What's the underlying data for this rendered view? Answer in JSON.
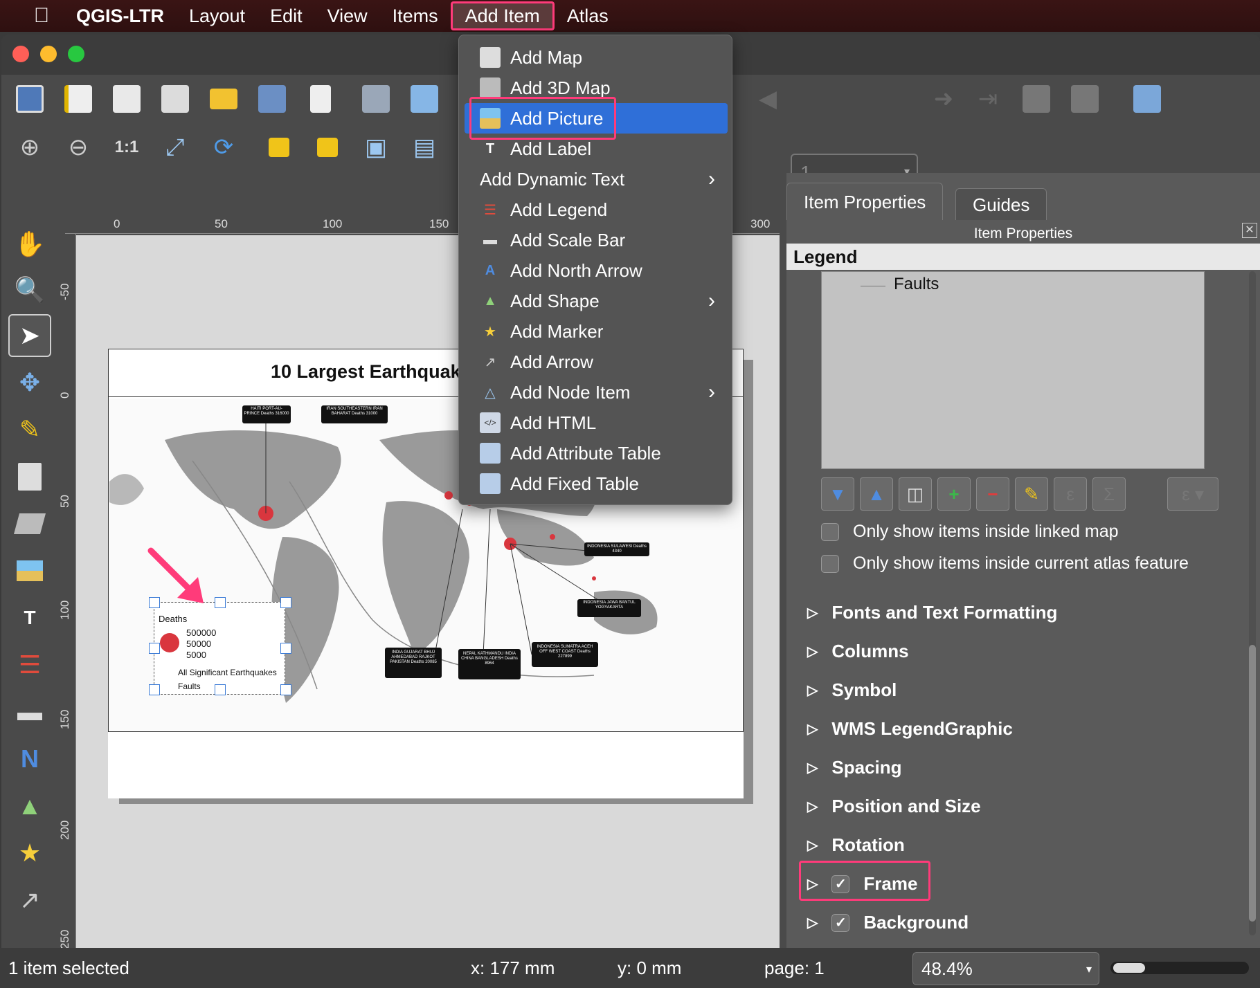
{
  "menubar": {
    "apple": "",
    "items": [
      "QGIS-LTR",
      "Layout",
      "Edit",
      "View",
      "Items",
      "Add Item",
      "Atlas"
    ]
  },
  "toolbar": {
    "page_number": "1"
  },
  "dropdown": {
    "items": [
      {
        "label": "Add Map",
        "icon": "map-icon"
      },
      {
        "label": "Add 3D Map",
        "icon": "3d-map-icon"
      },
      {
        "label": "Add Picture",
        "icon": "picture-icon",
        "highlighted": true
      },
      {
        "label": "Add Label",
        "icon": "label-icon"
      },
      {
        "label": "Add Dynamic Text",
        "icon": "",
        "submenu": true
      },
      {
        "label": "Add Legend",
        "icon": "legend-icon"
      },
      {
        "label": "Add Scale Bar",
        "icon": "scale-bar-icon"
      },
      {
        "label": "Add North Arrow",
        "icon": "north-arrow-icon"
      },
      {
        "label": "Add Shape",
        "icon": "shape-icon",
        "submenu": true
      },
      {
        "label": "Add Marker",
        "icon": "marker-icon"
      },
      {
        "label": "Add Arrow",
        "icon": "arrow-icon"
      },
      {
        "label": "Add Node Item",
        "icon": "node-item-icon",
        "submenu": true
      },
      {
        "label": "Add HTML",
        "icon": "html-icon"
      },
      {
        "label": "Add Attribute Table",
        "icon": "attribute-table-icon"
      },
      {
        "label": "Add Fixed Table",
        "icon": "fixed-table-icon"
      }
    ]
  },
  "ruler": {
    "h_labels": [
      "0",
      "50",
      "100",
      "150",
      "300"
    ],
    "v_labels": [
      "-50",
      "0",
      "50",
      "100",
      "150",
      "200",
      "250"
    ]
  },
  "layout": {
    "map_title": "10 Largest Earthquake",
    "legend": {
      "title": "Deaths",
      "sizes": [
        "500000",
        "50000",
        "5000"
      ],
      "entries": [
        "All Significant Earthquakes",
        "Faults"
      ]
    },
    "callouts": [
      "HAITI PORT-AU-PRINCE Deaths 316000",
      "IRAN SOUTHEASTERN IRAN BAHARAT Deaths 31000",
      "INDONESIA SULAWESI Deaths 4340",
      "INDONESIA JAWA BANTUL YOGYAKARTA",
      "INDIA GUJARAT BHUJ AHMEDABAD RAJKOT PAKISTAN Deaths 20085",
      "NEPAL KATHMANDU INDIA CHINA BANGLADESH Deaths 8964",
      "INDONESIA SUMATRA ACEH OFF WEST COAST Deaths 227899"
    ]
  },
  "panel": {
    "tabs": [
      "Item Properties",
      "Guides"
    ],
    "subtitle": "Item Properties",
    "section_header": "Legend",
    "tree_item": "Faults",
    "checkbox1": "Only show items inside linked map",
    "checkbox2": "Only show items inside current atlas feature",
    "sections": [
      {
        "label": "Fonts and Text Formatting",
        "checkbox": false
      },
      {
        "label": "Columns",
        "checkbox": false
      },
      {
        "label": "Symbol",
        "checkbox": false
      },
      {
        "label": "WMS LegendGraphic",
        "checkbox": false
      },
      {
        "label": "Spacing",
        "checkbox": false
      },
      {
        "label": "Position and Size",
        "checkbox": false
      },
      {
        "label": "Rotation",
        "checkbox": false
      },
      {
        "label": "Frame",
        "checkbox": true
      },
      {
        "label": "Background",
        "checkbox": true
      }
    ]
  },
  "status": {
    "selection": "1 item selected",
    "x": "x: 177 mm",
    "y": "y: 0 mm",
    "page": "page: 1",
    "zoom": "48.4%"
  },
  "colors": {
    "highlight": "#2f6fd8",
    "annotation": "#ff3b7a",
    "quake_dot": "#d9363e"
  }
}
